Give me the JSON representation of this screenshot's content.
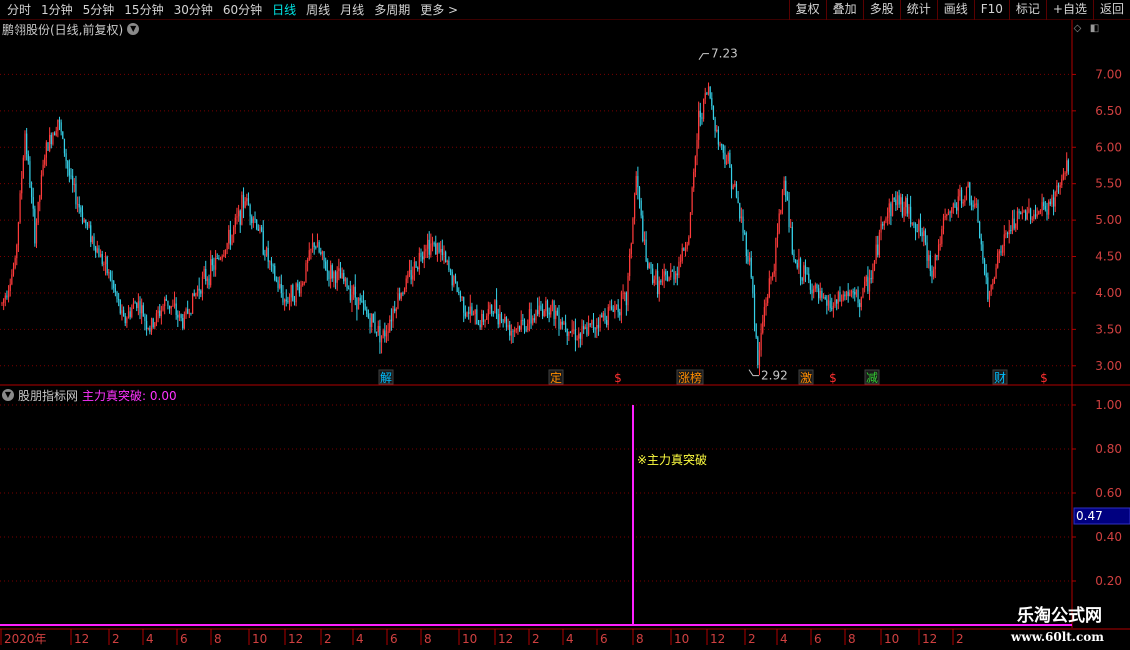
{
  "toolbar": {
    "periods": [
      "分时",
      "1分钟",
      "5分钟",
      "15分钟",
      "30分钟",
      "60分钟",
      "日线",
      "周线",
      "月线",
      "多周期",
      "更多"
    ],
    "active_period": "日线",
    "buttons": [
      "复权",
      "叠加",
      "多股",
      "统计",
      "画线",
      "F10",
      "标记",
      "+自选",
      "返回"
    ]
  },
  "main_chart": {
    "title": "鹏翎股份(日线,前复权)",
    "high_label": "7.23",
    "low_label": "2.92",
    "y_ticks": [
      "7.00",
      "6.50",
      "6.00",
      "5.50",
      "5.00",
      "4.50",
      "4.00",
      "3.50",
      "3.00"
    ],
    "event_markers": [
      {
        "label": "解",
        "color": "#00bfff"
      },
      {
        "label": "定",
        "color": "#ff8c00"
      },
      {
        "label": "$",
        "color": "#ff3030"
      },
      {
        "label": "涨榜",
        "color": "#ff8c00"
      },
      {
        "label": "激",
        "color": "#ff8c00"
      },
      {
        "label": "$",
        "color": "#ff3030"
      },
      {
        "label": "减",
        "color": "#33cc33"
      },
      {
        "label": "财",
        "color": "#00bfff"
      },
      {
        "label": "$",
        "color": "#ff3030"
      }
    ]
  },
  "sub_chart": {
    "indicator_name": "股朋指标网",
    "indicator_value_text": "主力真突破: 0.00",
    "signal_label": "※主力真突破",
    "y_ticks": [
      "1.00",
      "0.80",
      "0.60",
      "0.40",
      "0.20"
    ],
    "current_value": "0.47"
  },
  "x_axis": {
    "labels": [
      "2020年",
      "12",
      "2",
      "4",
      "6",
      "8",
      "10",
      "12",
      "2",
      "4",
      "6",
      "8",
      "10",
      "12",
      "2",
      "4",
      "6",
      "8",
      "10",
      "12",
      "2",
      "4",
      "6",
      "8",
      "10",
      "12",
      "2"
    ]
  },
  "watermark": {
    "title": "乐淘公式网",
    "url": "www.60lt.com"
  },
  "colors": {
    "up": "#ff3b3b",
    "down": "#35d0e8",
    "grid": "#7a0000",
    "axis": "#b00000",
    "signal": "#ff20ff",
    "highlight_bg": "#000080"
  },
  "chart_data": {
    "type": "candlestick",
    "ylim_main": [
      2.8,
      7.4
    ],
    "ylim_sub": [
      0,
      1.05
    ],
    "signal_values": [
      1.0
    ],
    "price_anchors": [
      [
        0,
        3.85
      ],
      [
        8,
        4.4
      ],
      [
        14,
        6.2
      ],
      [
        20,
        4.8
      ],
      [
        26,
        5.9
      ],
      [
        34,
        6.4
      ],
      [
        42,
        5.5
      ],
      [
        50,
        5.0
      ],
      [
        58,
        4.6
      ],
      [
        66,
        4.2
      ],
      [
        74,
        3.6
      ],
      [
        82,
        3.9
      ],
      [
        90,
        3.5
      ],
      [
        100,
        3.9
      ],
      [
        110,
        3.6
      ],
      [
        120,
        4.1
      ],
      [
        130,
        4.4
      ],
      [
        140,
        4.8
      ],
      [
        148,
        5.3
      ],
      [
        156,
        4.9
      ],
      [
        164,
        4.3
      ],
      [
        172,
        3.9
      ],
      [
        182,
        4.1
      ],
      [
        190,
        4.7
      ],
      [
        198,
        4.3
      ],
      [
        206,
        4.2
      ],
      [
        214,
        4.0
      ],
      [
        222,
        3.7
      ],
      [
        232,
        3.4
      ],
      [
        240,
        3.9
      ],
      [
        250,
        4.3
      ],
      [
        258,
        4.7
      ],
      [
        266,
        4.6
      ],
      [
        274,
        4.2
      ],
      [
        282,
        3.8
      ],
      [
        290,
        3.6
      ],
      [
        300,
        3.8
      ],
      [
        310,
        3.5
      ],
      [
        320,
        3.6
      ],
      [
        332,
        3.85
      ],
      [
        342,
        3.6
      ],
      [
        352,
        3.4
      ],
      [
        362,
        3.6
      ],
      [
        372,
        3.8
      ],
      [
        380,
        3.9
      ],
      [
        386,
        5.6
      ],
      [
        392,
        4.4
      ],
      [
        400,
        4.1
      ],
      [
        410,
        4.3
      ],
      [
        418,
        4.8
      ],
      [
        424,
        6.4
      ],
      [
        430,
        6.8
      ],
      [
        436,
        6.1
      ],
      [
        442,
        5.8
      ],
      [
        448,
        5.2
      ],
      [
        456,
        4.3
      ],
      [
        460,
        3.0
      ],
      [
        464,
        3.8
      ],
      [
        470,
        4.4
      ],
      [
        476,
        5.6
      ],
      [
        482,
        4.4
      ],
      [
        490,
        4.2
      ],
      [
        498,
        3.9
      ],
      [
        506,
        3.8
      ],
      [
        514,
        4.0
      ],
      [
        522,
        3.9
      ],
      [
        530,
        4.3
      ],
      [
        536,
        5.0
      ],
      [
        544,
        5.3
      ],
      [
        552,
        5.1
      ],
      [
        560,
        4.8
      ],
      [
        566,
        4.3
      ],
      [
        574,
        5.0
      ],
      [
        580,
        5.2
      ],
      [
        588,
        5.4
      ],
      [
        594,
        5.0
      ],
      [
        600,
        3.9
      ],
      [
        606,
        4.5
      ],
      [
        614,
        4.9
      ],
      [
        622,
        5.1
      ],
      [
        630,
        5.1
      ],
      [
        638,
        5.2
      ],
      [
        644,
        5.5
      ],
      [
        650,
        5.8
      ]
    ]
  }
}
